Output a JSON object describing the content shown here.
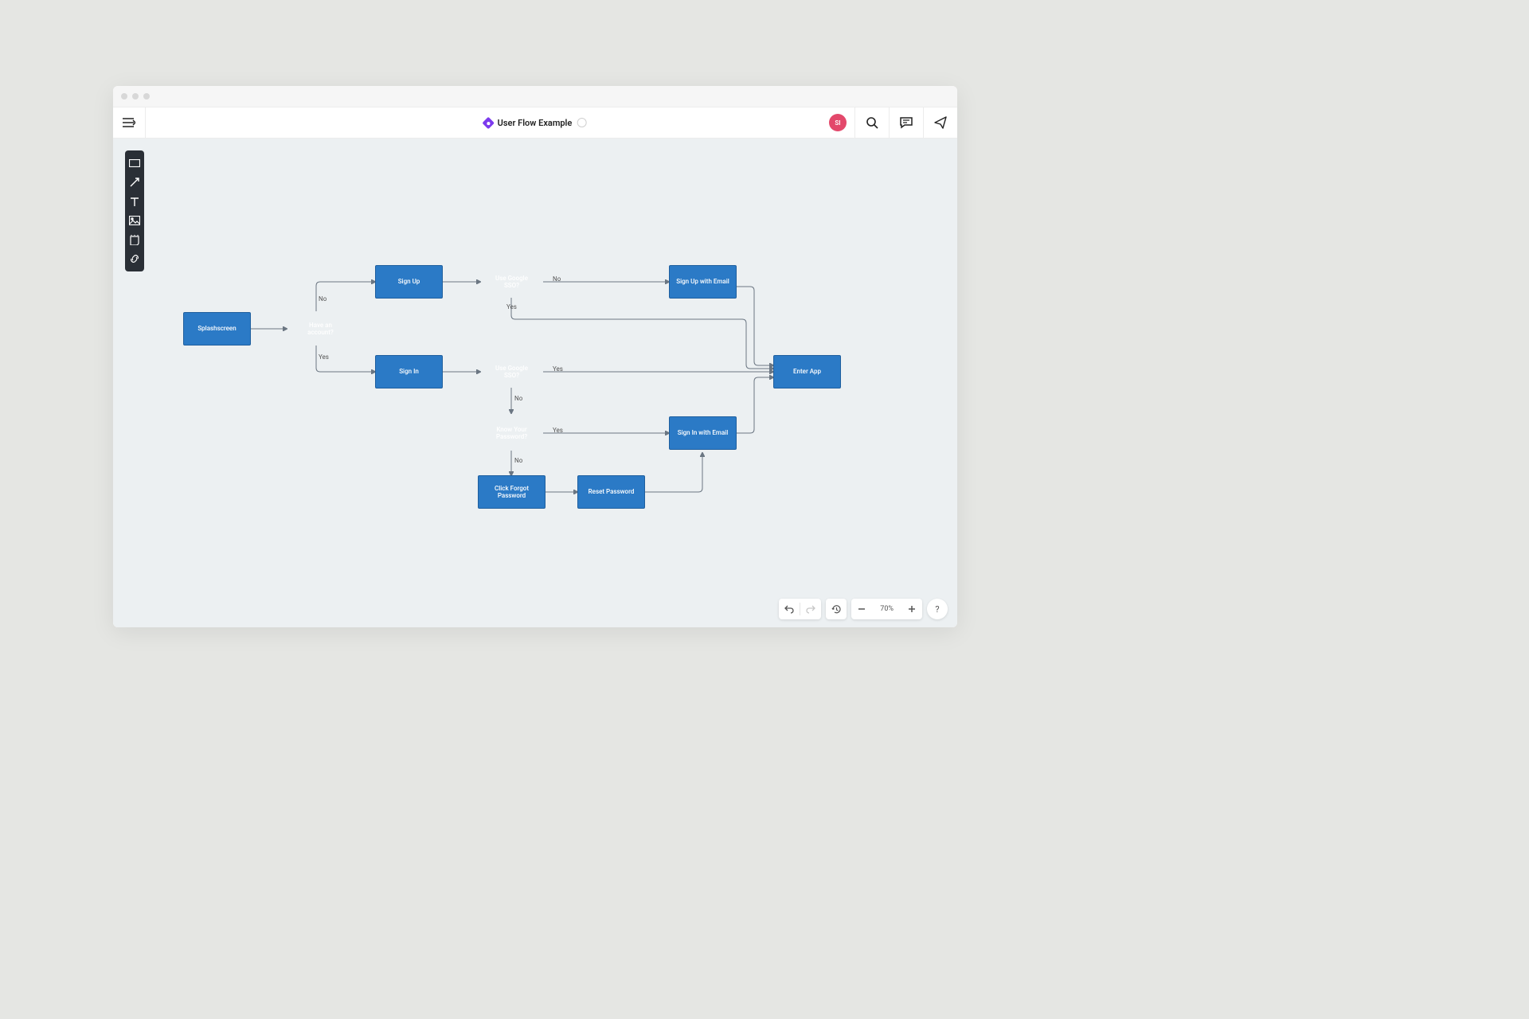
{
  "header": {
    "title": "User Flow Example",
    "avatar_initials": "SI"
  },
  "sidebar": {
    "tools": [
      "rectangle",
      "arrow",
      "text",
      "image",
      "sticky",
      "link"
    ]
  },
  "nodes": {
    "splashscreen": "Splashscreen",
    "have_account": "Have an account?",
    "sign_up": "Sign Up",
    "sign_in": "Sign In",
    "use_google_sso_1": "Use Google SSO?",
    "use_google_sso_2": "Use Google SSO?",
    "sign_up_email": "Sign Up with Email",
    "know_password": "Know Your Password?",
    "sign_in_email": "Sign In with Email",
    "click_forgot": "Click Forgot Password",
    "reset_password": "Reset Password",
    "enter_app": "Enter App"
  },
  "labels": {
    "yes": "Yes",
    "no": "No"
  },
  "footer": {
    "zoom": "70%",
    "help": "?"
  },
  "chart_data": {
    "type": "flowchart",
    "title": "User Flow Example",
    "nodes": [
      {
        "id": "splashscreen",
        "type": "process",
        "label": "Splashscreen"
      },
      {
        "id": "have_account",
        "type": "decision",
        "label": "Have an account?"
      },
      {
        "id": "sign_up",
        "type": "process",
        "label": "Sign Up"
      },
      {
        "id": "sign_in",
        "type": "process",
        "label": "Sign In"
      },
      {
        "id": "use_google_sso_1",
        "type": "decision",
        "label": "Use Google SSO?"
      },
      {
        "id": "use_google_sso_2",
        "type": "decision",
        "label": "Use Google SSO?"
      },
      {
        "id": "sign_up_email",
        "type": "process",
        "label": "Sign Up with Email"
      },
      {
        "id": "know_password",
        "type": "decision",
        "label": "Know Your Password?"
      },
      {
        "id": "sign_in_email",
        "type": "process",
        "label": "Sign In with Email"
      },
      {
        "id": "click_forgot",
        "type": "process",
        "label": "Click Forgot Password"
      },
      {
        "id": "reset_password",
        "type": "process",
        "label": "Reset Password"
      },
      {
        "id": "enter_app",
        "type": "process",
        "label": "Enter App"
      }
    ],
    "edges": [
      {
        "from": "splashscreen",
        "to": "have_account",
        "label": ""
      },
      {
        "from": "have_account",
        "to": "sign_up",
        "label": "No"
      },
      {
        "from": "have_account",
        "to": "sign_in",
        "label": "Yes"
      },
      {
        "from": "sign_up",
        "to": "use_google_sso_1",
        "label": ""
      },
      {
        "from": "use_google_sso_1",
        "to": "sign_up_email",
        "label": "No"
      },
      {
        "from": "use_google_sso_1",
        "to": "enter_app",
        "label": "Yes"
      },
      {
        "from": "sign_in",
        "to": "use_google_sso_2",
        "label": ""
      },
      {
        "from": "use_google_sso_2",
        "to": "enter_app",
        "label": "Yes"
      },
      {
        "from": "use_google_sso_2",
        "to": "know_password",
        "label": "No"
      },
      {
        "from": "know_password",
        "to": "sign_in_email",
        "label": "Yes"
      },
      {
        "from": "know_password",
        "to": "click_forgot",
        "label": "No"
      },
      {
        "from": "click_forgot",
        "to": "reset_password",
        "label": ""
      },
      {
        "from": "reset_password",
        "to": "sign_in_email",
        "label": ""
      },
      {
        "from": "sign_up_email",
        "to": "enter_app",
        "label": ""
      },
      {
        "from": "sign_in_email",
        "to": "enter_app",
        "label": ""
      }
    ]
  }
}
